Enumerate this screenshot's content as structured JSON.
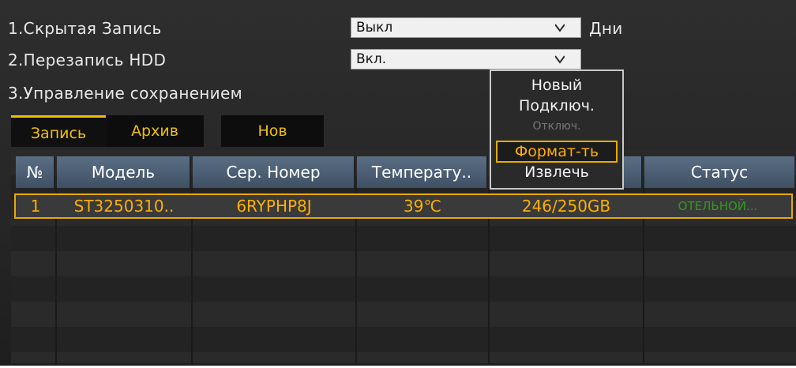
{
  "settings": [
    {
      "label": "1.Скрытая Запись",
      "value": "Выкл",
      "suffix": "Дни"
    },
    {
      "label": "2.Перезапись HDD",
      "value": "Вкл."
    },
    {
      "label": "3.Управление сохранением"
    }
  ],
  "tabs": [
    "Запись",
    "Архив",
    "Нов"
  ],
  "table": {
    "headers": [
      "№",
      "Модель",
      "Сер. Номер",
      "Температу..",
      "",
      "Статус"
    ],
    "rows": [
      [
        "1",
        "ST3250310..",
        "6RYPHP8J",
        "39℃",
        "246/250GB",
        "ОТЕЛЬНОЙ..."
      ]
    ]
  },
  "context_menu": {
    "items": [
      "Новый",
      "Подключ.",
      "Отключ.",
      "Формат-ть",
      "Извлечь"
    ],
    "disabled": [
      "Отключ."
    ],
    "highlighted": "Формат-ть"
  },
  "colors": {
    "accent": "#ffb000",
    "status_text": "#2f9a20",
    "header": "#4c5e74"
  }
}
